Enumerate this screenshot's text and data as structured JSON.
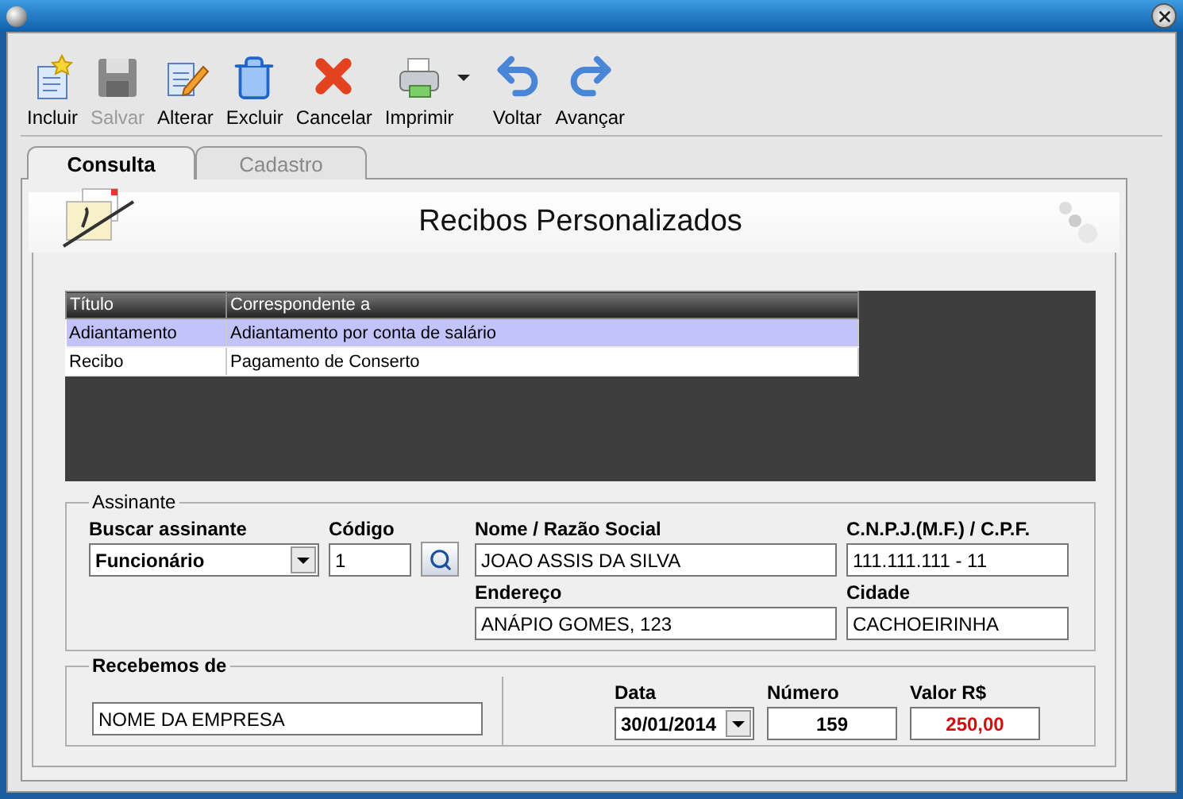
{
  "toolbar": {
    "buttons": [
      {
        "kind": "new",
        "label": "Incluir",
        "disabled": false
      },
      {
        "kind": "save",
        "label": "Salvar",
        "disabled": true
      },
      {
        "kind": "edit",
        "label": "Alterar",
        "disabled": false
      },
      {
        "kind": "delete",
        "label": "Excluir",
        "disabled": false
      },
      {
        "kind": "cancel",
        "label": "Cancelar",
        "disabled": false
      },
      {
        "kind": "print",
        "label": "Imprimir",
        "disabled": false,
        "has_menu": true
      },
      {
        "kind": "back",
        "label": "Voltar",
        "disabled": false
      },
      {
        "kind": "forward",
        "label": "Avançar",
        "disabled": false
      }
    ]
  },
  "tabs": [
    {
      "label": "Consulta",
      "selected": true
    },
    {
      "label": "Cadastro",
      "selected": false
    }
  ],
  "header": {
    "title": "Recibos Personalizados"
  },
  "table": {
    "columns": [
      "Título",
      "Correspondente a"
    ],
    "rows": [
      {
        "cells": [
          "Adiantamento",
          "Adiantamento por conta de salário"
        ],
        "selected": true
      },
      {
        "cells": [
          "Recibo",
          "Pagamento de Conserto"
        ],
        "selected": false
      }
    ]
  },
  "signer": {
    "legend": "Assinante",
    "search": {
      "label": "Buscar assinante",
      "value": "Funcionário"
    },
    "code": {
      "label": "Código",
      "value": "1"
    },
    "name": {
      "label": "Nome / Razão Social",
      "value": "JOAO ASSIS DA SILVA"
    },
    "tax_id": {
      "label": "C.N.P.J.(M.F.) / C.P.F.",
      "value": "111.111.111 - 11"
    },
    "address": {
      "label": "Endereço",
      "value": "ANÁPIO GOMES, 123"
    },
    "city": {
      "label": "Cidade",
      "value": "CACHOEIRINHA"
    }
  },
  "received": {
    "legend": "Recebemos de",
    "payer": {
      "value": "NOME DA EMPRESA"
    },
    "fields": [
      {
        "kind": "date",
        "label": "Data",
        "value": "30/01/2014"
      },
      {
        "kind": "number",
        "label": "Número",
        "value": "159"
      },
      {
        "kind": "money",
        "label": "Valor R$",
        "value": "250,00"
      }
    ]
  }
}
